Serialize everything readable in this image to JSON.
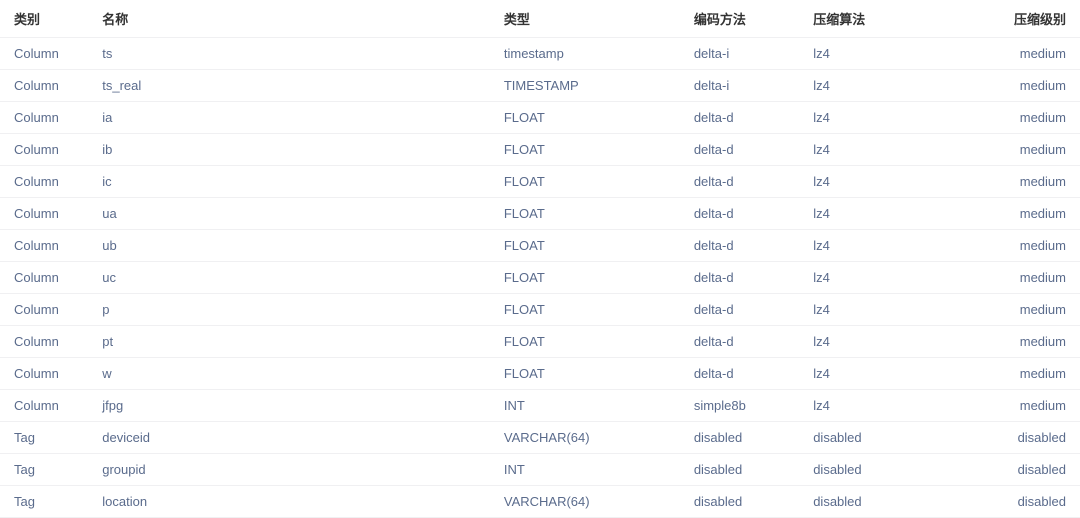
{
  "headers": {
    "category": "类别",
    "name": "名称",
    "type": "类型",
    "encoding": "编码方法",
    "compress_algo": "压缩算法",
    "compress_level": "压缩级别"
  },
  "rows": [
    {
      "category": "Column",
      "name": "ts",
      "type": "timestamp",
      "encoding": "delta-i",
      "compress_algo": "lz4",
      "compress_level": "medium"
    },
    {
      "category": "Column",
      "name": "ts_real",
      "type": "TIMESTAMP",
      "encoding": "delta-i",
      "compress_algo": "lz4",
      "compress_level": "medium"
    },
    {
      "category": "Column",
      "name": "ia",
      "type": "FLOAT",
      "encoding": "delta-d",
      "compress_algo": "lz4",
      "compress_level": "medium"
    },
    {
      "category": "Column",
      "name": "ib",
      "type": "FLOAT",
      "encoding": "delta-d",
      "compress_algo": "lz4",
      "compress_level": "medium"
    },
    {
      "category": "Column",
      "name": "ic",
      "type": "FLOAT",
      "encoding": "delta-d",
      "compress_algo": "lz4",
      "compress_level": "medium"
    },
    {
      "category": "Column",
      "name": "ua",
      "type": "FLOAT",
      "encoding": "delta-d",
      "compress_algo": "lz4",
      "compress_level": "medium"
    },
    {
      "category": "Column",
      "name": "ub",
      "type": "FLOAT",
      "encoding": "delta-d",
      "compress_algo": "lz4",
      "compress_level": "medium"
    },
    {
      "category": "Column",
      "name": "uc",
      "type": "FLOAT",
      "encoding": "delta-d",
      "compress_algo": "lz4",
      "compress_level": "medium"
    },
    {
      "category": "Column",
      "name": "p",
      "type": "FLOAT",
      "encoding": "delta-d",
      "compress_algo": "lz4",
      "compress_level": "medium"
    },
    {
      "category": "Column",
      "name": "pt",
      "type": "FLOAT",
      "encoding": "delta-d",
      "compress_algo": "lz4",
      "compress_level": "medium"
    },
    {
      "category": "Column",
      "name": "w",
      "type": "FLOAT",
      "encoding": "delta-d",
      "compress_algo": "lz4",
      "compress_level": "medium"
    },
    {
      "category": "Column",
      "name": "jfpg",
      "type": "INT",
      "encoding": "simple8b",
      "compress_algo": "lz4",
      "compress_level": "medium"
    },
    {
      "category": "Tag",
      "name": "deviceid",
      "type": "VARCHAR(64)",
      "encoding": "disabled",
      "compress_algo": "disabled",
      "compress_level": "disabled"
    },
    {
      "category": "Tag",
      "name": "groupid",
      "type": "INT",
      "encoding": "disabled",
      "compress_algo": "disabled",
      "compress_level": "disabled"
    },
    {
      "category": "Tag",
      "name": "location",
      "type": "VARCHAR(64)",
      "encoding": "disabled",
      "compress_algo": "disabled",
      "compress_level": "disabled"
    }
  ]
}
